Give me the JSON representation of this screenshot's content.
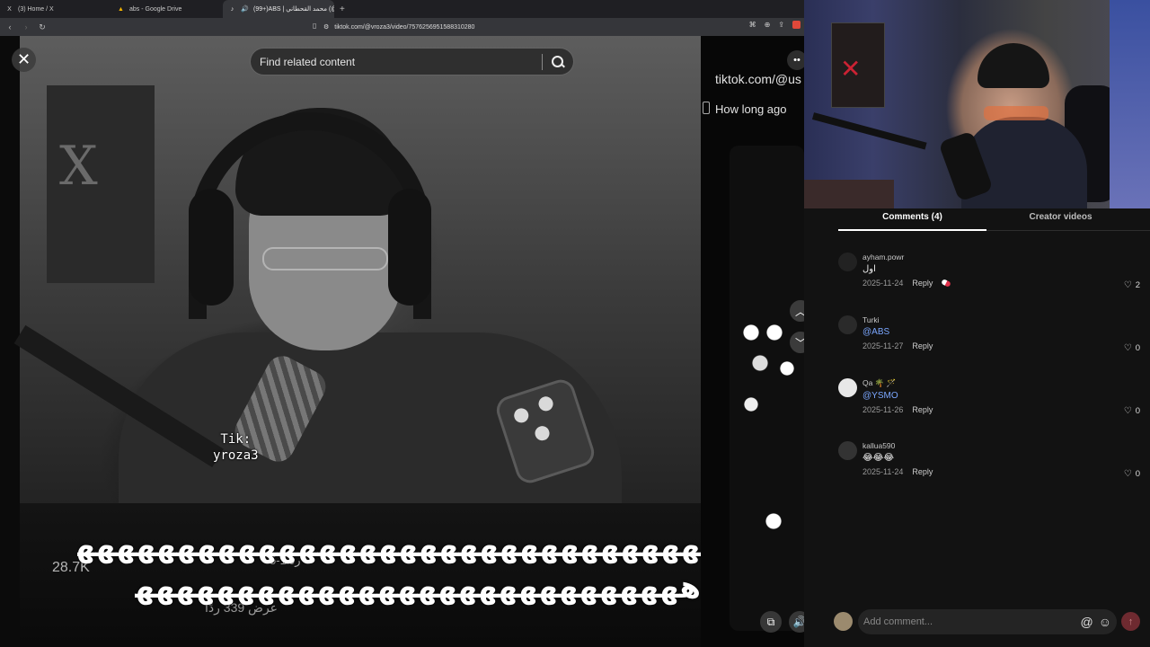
{
  "browser": {
    "tabs": [
      {
        "icon": "X",
        "label": "(3) Home / X",
        "active": false
      },
      {
        "icon": "▲",
        "label": "abs - Google Drive",
        "active": false
      },
      {
        "icon": "♪",
        "label": "(99+)ABS | محمد القحطاني (@",
        "active": true
      }
    ],
    "new_tab": "+",
    "url": "tiktok.com/@vroza3/video/7576256951588310280"
  },
  "viewer": {
    "search_placeholder": "Find related content",
    "side_url": "tiktok.com/@us",
    "side_ago": "How long ago",
    "watermark_line1": "Tik:",
    "watermark_line2": "yroza3",
    "overlay_line1": "ههههههههههههههههههههههههههههههههههه",
    "overlay_line2": "ههههههههههههههههههههههههههههه",
    "ghost_count": "28.7K",
    "ghost_reply": "رد  1-5",
    "ghost_replies": "عرض 339 ردًا"
  },
  "comments_panel": {
    "tabs": [
      {
        "label": "Comments (4)",
        "active": true
      },
      {
        "label": "Creator videos",
        "active": false
      }
    ],
    "comments": [
      {
        "user": "ayham.powr",
        "text": "اول",
        "mention": false,
        "date": "2025-11-24",
        "reply": "Reply",
        "likes": "2",
        "creator_liked": true
      },
      {
        "user": "Turki",
        "text": "@ABS",
        "mention": true,
        "date": "2025-11-27",
        "reply": "Reply",
        "likes": "0",
        "creator_liked": false
      },
      {
        "user": "Qa 🌴 🪄",
        "text": "@YSMO",
        "mention": true,
        "date": "2025-11-26",
        "reply": "Reply",
        "likes": "0",
        "creator_liked": false
      },
      {
        "user": "kallua590",
        "text": "😂😂😂",
        "mention": false,
        "date": "2025-11-24",
        "reply": "Reply",
        "likes": "0",
        "creator_liked": false
      }
    ],
    "composer_placeholder": "Add comment...",
    "at_symbol": "@",
    "emoji_symbol": "☺",
    "send_symbol": "↑"
  },
  "colors": {
    "accent_send": "#6e2a30",
    "mention": "#7ba7ff",
    "panel_bg": "#121212"
  }
}
